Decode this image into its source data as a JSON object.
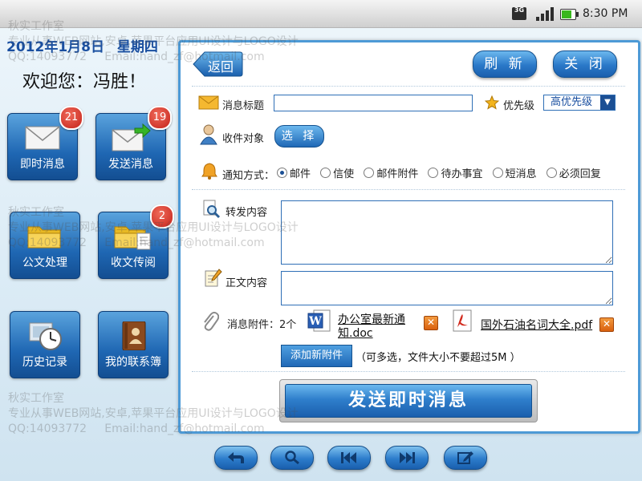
{
  "status_bar": {
    "network": "3G",
    "time": "8:30 PM"
  },
  "date": {
    "year_prefix": "2012年",
    "month_day": "1月8日",
    "weekday": "星期四"
  },
  "welcome": "欢迎您：冯胜！",
  "tiles": [
    {
      "label": "即时消息",
      "icon": "envelope-icon",
      "badge": "21"
    },
    {
      "label": "发送消息",
      "icon": "send-mail-icon",
      "badge": "19"
    },
    {
      "label": "公文处理",
      "icon": "folder-icon",
      "badge": ""
    },
    {
      "label": "收文传阅",
      "icon": "folder-document-icon",
      "badge": "2"
    },
    {
      "label": "历史记录",
      "icon": "clock-icon",
      "badge": ""
    },
    {
      "label": "我的联系簿",
      "icon": "contacts-book-icon",
      "badge": ""
    }
  ],
  "toolbar": {
    "back": "返回",
    "refresh": "刷 新",
    "close": "关 闭"
  },
  "form": {
    "subject_label": "消息标题",
    "subject_value": "",
    "priority_label": "优先级",
    "priority_value": "高优先级",
    "recipients_label": "收件对象",
    "choose_label": "选 择",
    "notify_label": "通知方式：",
    "notify_options": [
      "邮件",
      "信使",
      "邮件附件",
      "待办事宜",
      "短消息",
      "必须回复"
    ],
    "notify_selected": "邮件",
    "forward_label": "转发内容",
    "body_label": "正文内容",
    "attachments_label": "消息附件：2个",
    "attachments": [
      {
        "name_line1": "办公室最新通",
        "name_line2": "知.doc",
        "icon": "word-doc-icon"
      },
      {
        "name_line1": "国外石油名词大全.pdf",
        "icon": "pdf-icon"
      }
    ],
    "add_attachment": "添加新附件",
    "attachment_hint": "（可多选，文件大小不要超过5M ）",
    "send_button": "发送即时消息"
  },
  "bottom_bar": [
    "back-arrow-icon",
    "search-icon",
    "skip-back-icon",
    "skip-forward-icon",
    "edit-icon"
  ],
  "watermark": {
    "studio": "秋实工作室",
    "line2": "专业从事WEB网站,安卓,苹果平台应用UI设计与LOGO设计",
    "line3": "QQ:14093772     Email:hand_zf@hotmail.com"
  },
  "colors": {
    "accent": "#2a78c8",
    "panel_border": "#4d9ad6",
    "badge": "#d0281c",
    "date": "#1a4fa0"
  }
}
